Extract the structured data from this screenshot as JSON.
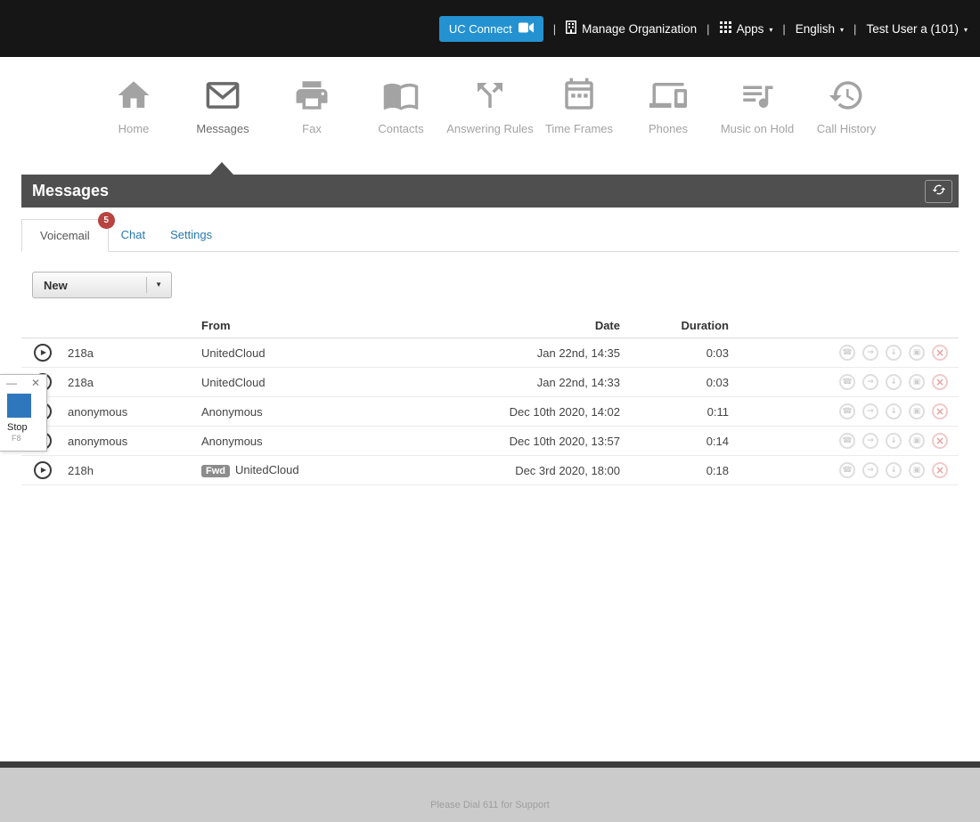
{
  "topbar": {
    "uc_connect_label": "UC Connect",
    "separator": "|",
    "manage_org_label": "Manage Organization",
    "apps_label": "Apps",
    "language_label": "English",
    "user_label": "Test User a (101)",
    "caret": "▾"
  },
  "nav": {
    "active": "Messages",
    "items": [
      {
        "label": "Home"
      },
      {
        "label": "Messages"
      },
      {
        "label": "Fax"
      },
      {
        "label": "Contacts"
      },
      {
        "label": "Answering Rules"
      },
      {
        "label": "Time Frames"
      },
      {
        "label": "Phones"
      },
      {
        "label": "Music on Hold"
      },
      {
        "label": "Call History"
      }
    ]
  },
  "panel": {
    "title": "Messages"
  },
  "tabs": {
    "voicemail": {
      "label": "Voicemail",
      "badge": "5"
    },
    "chat": {
      "label": "Chat"
    },
    "settings": {
      "label": "Settings"
    }
  },
  "filter": {
    "selected_option": "New",
    "caret": "▼"
  },
  "table": {
    "headers": {
      "from": "From",
      "date": "Date",
      "duration": "Duration"
    },
    "rows": [
      {
        "caller": "218a",
        "from": "UnitedCloud",
        "date": "Jan 22nd, 14:35",
        "duration": "0:03"
      },
      {
        "caller": "218a",
        "from": "UnitedCloud",
        "date": "Jan 22nd, 14:33",
        "duration": "0:03"
      },
      {
        "caller": "anonymous",
        "from": "Anonymous",
        "date": "Dec 10th 2020, 14:02",
        "duration": "0:11"
      },
      {
        "caller": "anonymous",
        "from": "Anonymous",
        "date": "Dec 10th 2020, 13:57",
        "duration": "0:14"
      },
      {
        "caller": "218h",
        "from": "UnitedCloud",
        "fwd_label": "Fwd",
        "date": "Dec 3rd 2020, 18:00",
        "duration": "0:18"
      }
    ]
  },
  "icons": {
    "play": "▶",
    "call": "☎",
    "forward": "→",
    "download": "↓",
    "save": "▣",
    "delete": "×"
  },
  "recorder": {
    "minimize": "—",
    "close": "✕",
    "stop_label": "Stop",
    "hotkey": "F8"
  },
  "footer": {
    "support_text": "Please Dial 611 for Support"
  },
  "colors": {
    "accent_blue": "#2492d0",
    "badge_red": "#b8433f",
    "panel_gray": "#4f4f4f",
    "link_blue": "#2779b0",
    "topbar_black": "#161616",
    "recorder_stop_blue": "#2f77bd"
  }
}
